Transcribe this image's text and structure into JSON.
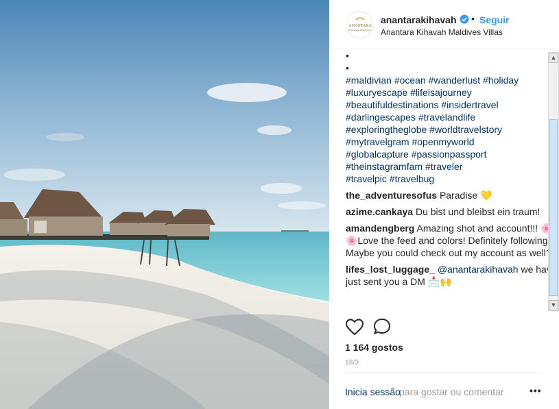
{
  "post": {
    "username": "anantarakihavah",
    "follow_label": "Seguir",
    "dot": "•",
    "location": "Anantara Kihavah Maldives Villas",
    "avatar_text": "ANANTARA",
    "avatar_subtext": "KIHAVAH MALDIVES VILLAS"
  },
  "caption": {
    "bullets": [
      "•",
      "•"
    ],
    "hashtag_lines": [
      "#maldivian #ocean #wanderlust #holiday",
      "#luxuryescape #lifeisajourney",
      "#beautifuldestinations #insidertravel",
      "#darlingescapes #travelandlife",
      "#exploringtheglobe #worldtravelstory",
      "#mytravelgram #openmyworld",
      "#globalcapture #passionpassport",
      "#theinstagramfam #traveler",
      "#travelpic #travelbug"
    ]
  },
  "comments": [
    {
      "user": "the_adventuresofus",
      "text": "Paradise 💛"
    },
    {
      "user": "azime.cankaya",
      "text": "Du bist und bleibst ein traum!"
    },
    {
      "user": "amandengberg",
      "text": "Amazing shot and account!!! 🌸🌸🌸Love the feed and colors! Definitely following! Maybe you could check out my account as well?"
    },
    {
      "user": "lifes_lost_luggage_",
      "mention": "@anantarakihavah",
      "text": "we have just sent you a DM 📩🙌"
    }
  ],
  "icons": {
    "like": "heart-icon",
    "comment": "comment-bubble-icon",
    "verified": "verified-badge-icon",
    "more": "more-options-icon"
  },
  "likes_label": "1 164 gostos",
  "date_label": "18/3",
  "login_link": "Inicia sessão",
  "login_rest": "para gostar ou comentar",
  "more_label": "•••",
  "scrollbar": {
    "up": "▲",
    "down": "▼"
  },
  "colors": {
    "link_blue": "#3897f0",
    "hashtag": "#003569",
    "verified": "#3897f0"
  }
}
